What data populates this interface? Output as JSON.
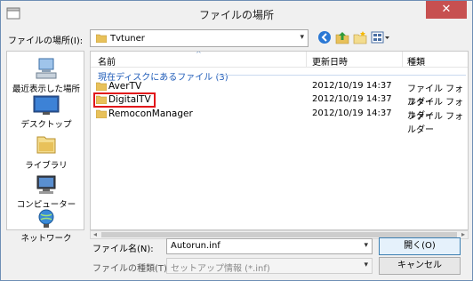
{
  "window": {
    "title": "ファイルの場所",
    "close_label": "✕"
  },
  "location": {
    "label": "ファイルの場所(I):",
    "value": "Tvtuner"
  },
  "toolbar": {
    "icons": [
      "back-icon",
      "up-folder-icon",
      "new-folder-icon",
      "view-menu-icon"
    ]
  },
  "places": [
    {
      "name": "recent",
      "label": "最近表示した場所"
    },
    {
      "name": "desktop",
      "label": "デスクトップ"
    },
    {
      "name": "libraries",
      "label": "ライブラリ"
    },
    {
      "name": "computer",
      "label": "コンピューター"
    },
    {
      "name": "network",
      "label": "ネットワーク"
    }
  ],
  "list": {
    "columns": {
      "name": "名前",
      "date": "更新日時",
      "type": "種類"
    },
    "group_label": "現在ディスクにあるファイル (3)",
    "rows": [
      {
        "name": "AverTV",
        "date": "2012/10/19 14:37",
        "type": "ファイル フォルダー"
      },
      {
        "name": "DigitalTV",
        "date": "2012/10/19 14:37",
        "type": "ファイル フォルダー"
      },
      {
        "name": "RemoconManager",
        "date": "2012/10/19 14:37",
        "type": "ファイル フォルダー"
      }
    ]
  },
  "filename": {
    "label": "ファイル名(N):",
    "value": "Autorun.inf"
  },
  "filetype": {
    "label": "ファイルの種類(T):",
    "value": "セットアップ情報 (*.inf)"
  },
  "buttons": {
    "open": "開く(O)",
    "cancel": "キャンセル"
  },
  "colors": {
    "highlight": "#e1151a",
    "group": "#1e5bb8",
    "folder": "#e8c15a"
  }
}
